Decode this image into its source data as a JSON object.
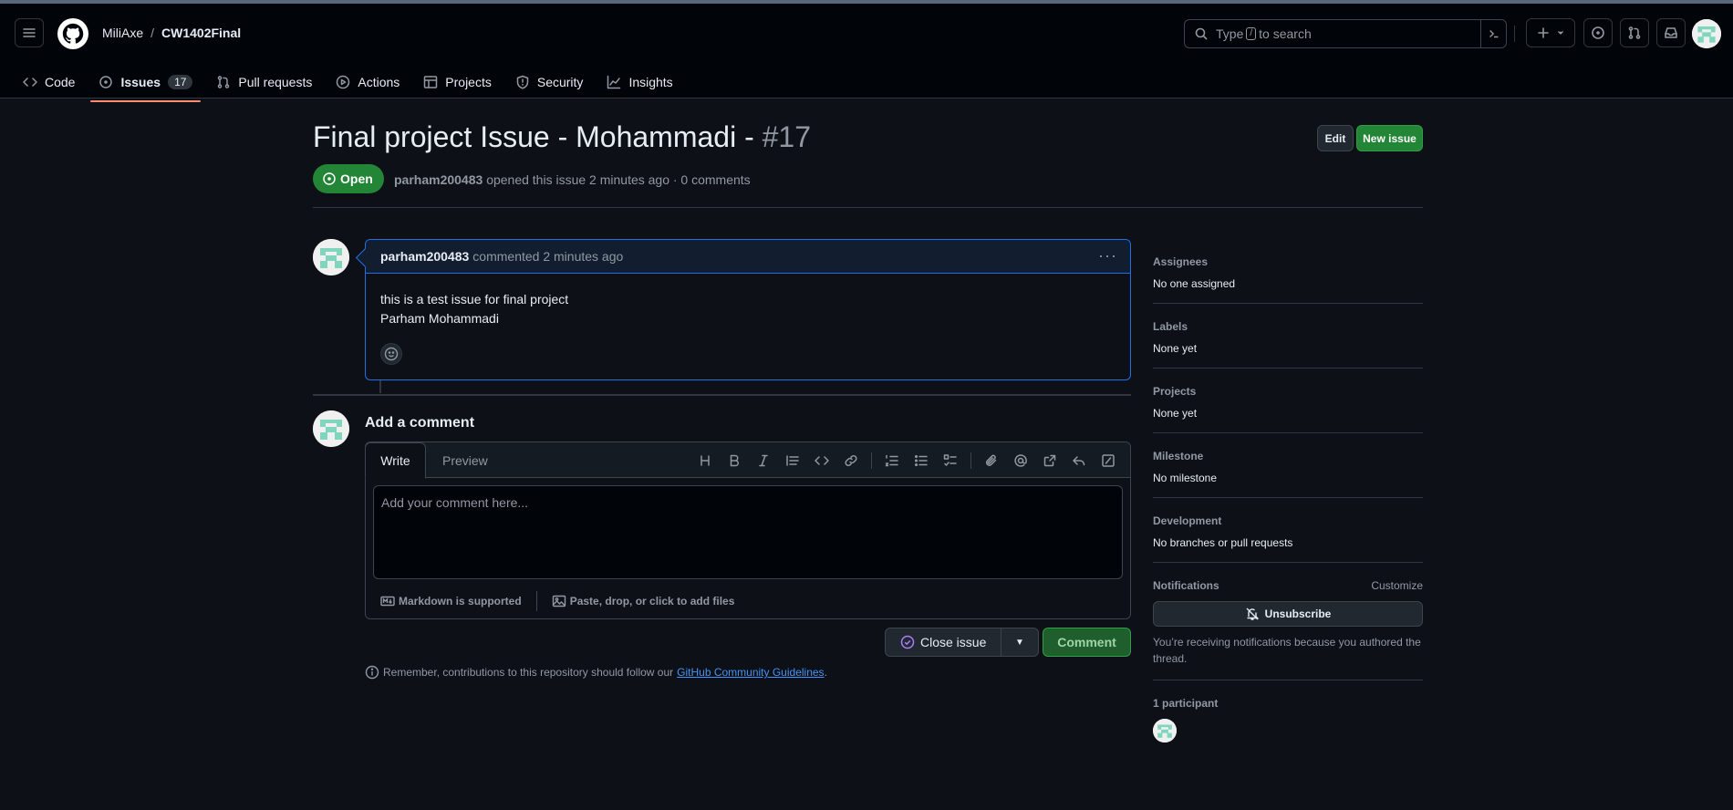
{
  "header": {
    "owner": "MiliAxe",
    "separator": "/",
    "repo": "CW1402Final",
    "search_before": "Type",
    "search_key": "/",
    "search_after": "to search"
  },
  "tabs": [
    {
      "label": "Code",
      "icon": "code-icon"
    },
    {
      "label": "Issues",
      "icon": "issue-opened-icon",
      "count": "17"
    },
    {
      "label": "Pull requests",
      "icon": "git-pull-request-icon"
    },
    {
      "label": "Actions",
      "icon": "play-icon"
    },
    {
      "label": "Projects",
      "icon": "table-icon"
    },
    {
      "label": "Security",
      "icon": "shield-icon"
    },
    {
      "label": "Insights",
      "icon": "graph-icon"
    }
  ],
  "issue": {
    "title": "Final project Issue - Mohammadi - ",
    "number": "#17",
    "edit_label": "Edit",
    "new_issue_label": "New issue",
    "state": "Open",
    "author": "parham200483",
    "meta_text": "opened this issue 2 minutes ago · 0 comments"
  },
  "comment": {
    "author": "parham200483",
    "meta": "commented 2 minutes ago",
    "line1": "this is a test issue for final project",
    "line2": "Parham Mohammadi"
  },
  "composer": {
    "heading": "Add a comment",
    "tab_write": "Write",
    "tab_preview": "Preview",
    "placeholder": "Add your comment here...",
    "markdown_note": "Markdown is supported",
    "attach_note": "Paste, drop, or click to add files",
    "close_issue_label": "Close issue",
    "comment_label": "Comment",
    "remember_text": "Remember, contributions to this repository should follow our",
    "guidelines_link": "GitHub Community Guidelines",
    "remember_end": "."
  },
  "sidebar": {
    "assignees_heading": "Assignees",
    "assignees_value": "No one assigned",
    "labels_heading": "Labels",
    "labels_value": "None yet",
    "projects_heading": "Projects",
    "projects_value": "None yet",
    "milestone_heading": "Milestone",
    "milestone_value": "No milestone",
    "development_heading": "Development",
    "development_value": "No branches or pull requests",
    "notifications_heading": "Notifications",
    "customize_label": "Customize",
    "unsubscribe_label": "Unsubscribe",
    "notifications_text": "You’re receiving notifications because you authored the thread.",
    "participants_heading": "1 participant"
  },
  "colors": {
    "accent_green": "#238636",
    "tab_underline": "#fd8c73",
    "link_blue": "#4493f8",
    "comment_border": "#1f6feb"
  }
}
